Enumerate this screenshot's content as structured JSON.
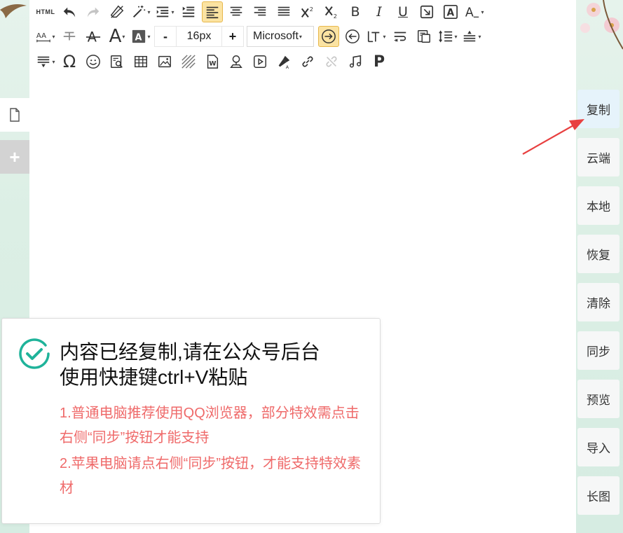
{
  "toolbar": {
    "html_label": "HTML",
    "font_size": "16px",
    "decrease_label": "-",
    "increase_label": "+",
    "font_family": "Microsoft",
    "bold_label": "B",
    "italic_label": "I",
    "underline_label": "U",
    "omega_label": "Ω",
    "paragraph_label": "P",
    "font_color_label": "A",
    "active_color": "#fbe3a2"
  },
  "sidebar": {
    "items": [
      {
        "label": "复制"
      },
      {
        "label": "云端"
      },
      {
        "label": "本地"
      },
      {
        "label": "恢复"
      },
      {
        "label": "清除"
      },
      {
        "label": "同步"
      },
      {
        "label": "预览"
      },
      {
        "label": "导入"
      },
      {
        "label": "长图"
      }
    ]
  },
  "toast": {
    "title_line1": "内容已经复制,请在公众号后台",
    "title_line2": "使用快捷键ctrl+V粘贴",
    "note1": "1.普通电脑推荐使用QQ浏览器，部分特效需点击右侧“同步”按钮才能支持",
    "note2": "2.苹果电脑请点右侧“同步”按钮，才能支持特效素材",
    "accent_color": "#1fb39a",
    "note_color": "#ef6a6a"
  },
  "colors": {
    "annotation_arrow": "#e84040",
    "background": "#dcefe5"
  }
}
